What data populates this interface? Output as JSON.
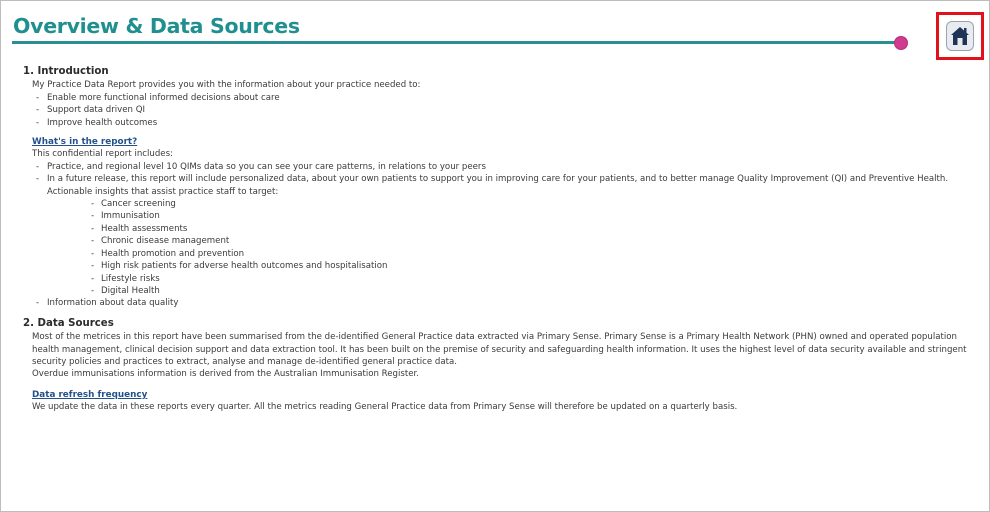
{
  "page": {
    "title": "Overview & Data Sources",
    "home_icon": "home-icon",
    "accent_color": "#2a8f92",
    "title_color": "#1f8f8f",
    "dot_color": "#d13b8d"
  },
  "intro": {
    "heading": "1. Introduction",
    "lead": "My Practice Data Report provides you with the information about your practice needed to:",
    "items": [
      "Enable more functional informed decisions about care",
      "Support data driven QI",
      "Improve health outcomes"
    ]
  },
  "report": {
    "heading": "What's in the report?",
    "lead": "This confidential report includes:",
    "item1": "Practice, and regional level 10 QIMs data so you can see your care patterns, in relations to your peers",
    "item2": "In a future release, this report will include personalized data, about your own patients to support you in improving care for your patients, and to better manage Quality Improvement (QI) and Preventive Health. Actionable insights that assist practice staff to target:",
    "subitems": [
      "Cancer screening",
      "Immunisation",
      "Health assessments",
      "Chronic disease management",
      "Health promotion and prevention",
      "High risk patients for adverse health outcomes and hospitalisation",
      "Lifestyle risks",
      "Digital Health"
    ],
    "item3": "Information about data quality"
  },
  "sources": {
    "heading": "2. Data Sources",
    "para1": "Most of the metrices in this report have been summarised from the de-identified General Practice data extracted via Primary Sense. Primary Sense is a Primary Health Network (PHN) owned and operated population health management, clinical decision support and data extraction tool. It has been built on the premise of security and safeguarding health information. It uses the highest level of data security available and stringent security policies and practices to extract, analyse and manage de-identified general practice data.",
    "para2": "Overdue immunisations information is derived from the Australian Immunisation Register."
  },
  "refresh": {
    "heading": "Data refresh frequency",
    "text": "We update the data in these reports every quarter. All the metrics reading General Practice data from Primary Sense will therefore be updated on a quarterly basis."
  }
}
